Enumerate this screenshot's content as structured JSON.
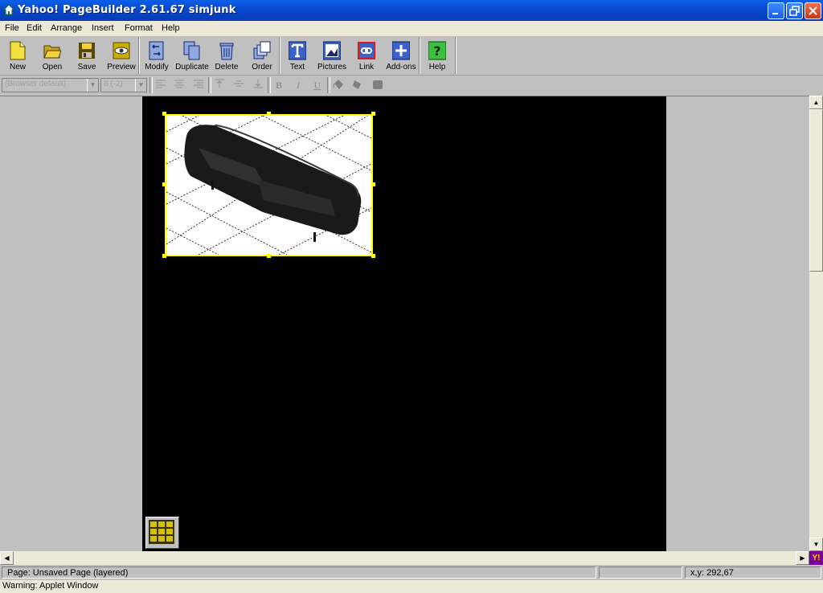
{
  "window": {
    "title": "Yahoo! PageBuilder 2.61.67 simjunk"
  },
  "menu": [
    "File",
    "Edit",
    "Arrange",
    "Insert",
    "Format",
    "Help"
  ],
  "toolbar": [
    {
      "label": "New",
      "icon": "new-page-icon"
    },
    {
      "label": "Open",
      "icon": "open-folder-icon"
    },
    {
      "label": "Save",
      "icon": "floppy-disk-icon"
    },
    {
      "label": "Preview",
      "icon": "eye-icon"
    },
    {
      "label": "Modify",
      "icon": "modify-icon"
    },
    {
      "label": "Duplicate",
      "icon": "duplicate-icon"
    },
    {
      "label": "Delete",
      "icon": "trash-icon"
    },
    {
      "label": "Order",
      "icon": "order-icon"
    },
    {
      "label": "Text",
      "icon": "text-icon"
    },
    {
      "label": "Pictures",
      "icon": "picture-icon"
    },
    {
      "label": "Link",
      "icon": "link-icon"
    },
    {
      "label": "Add-ons",
      "icon": "plus-icon"
    },
    {
      "label": "Help",
      "icon": "question-icon"
    }
  ],
  "format": {
    "font_family": "(Browser default)",
    "font_size": "8 (-2)",
    "bold": "B",
    "italic": "I",
    "underline": "U"
  },
  "status": {
    "page": "Page: Unsaved Page (layered)",
    "coords": "x,y: 292,67",
    "warning": "Warning: Applet Window"
  },
  "colors": {
    "canvas": "#000000",
    "selection": "#ffff00",
    "titlebar": "#0845c9"
  }
}
